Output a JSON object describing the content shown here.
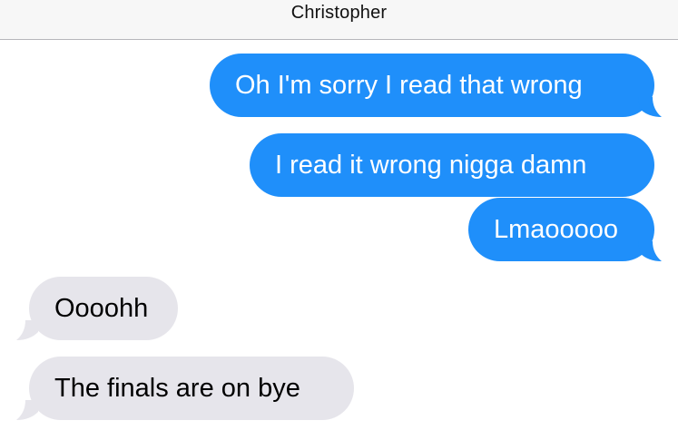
{
  "conversation": {
    "contact_name": "Christopher"
  },
  "messages": [
    {
      "direction": "sent",
      "text": "Oh I'm sorry I read that wrong",
      "color": "#1f8ffa"
    },
    {
      "direction": "sent",
      "text": "I read it wrong nigga damn",
      "color": "#1f8ffa"
    },
    {
      "direction": "sent",
      "text": "Lmaooooo",
      "color": "#1f8ffa"
    },
    {
      "direction": "received",
      "text": "Oooohh",
      "color": "#e6e5eb"
    },
    {
      "direction": "received",
      "text": "The finals are on bye",
      "color": "#e6e5eb"
    }
  ]
}
